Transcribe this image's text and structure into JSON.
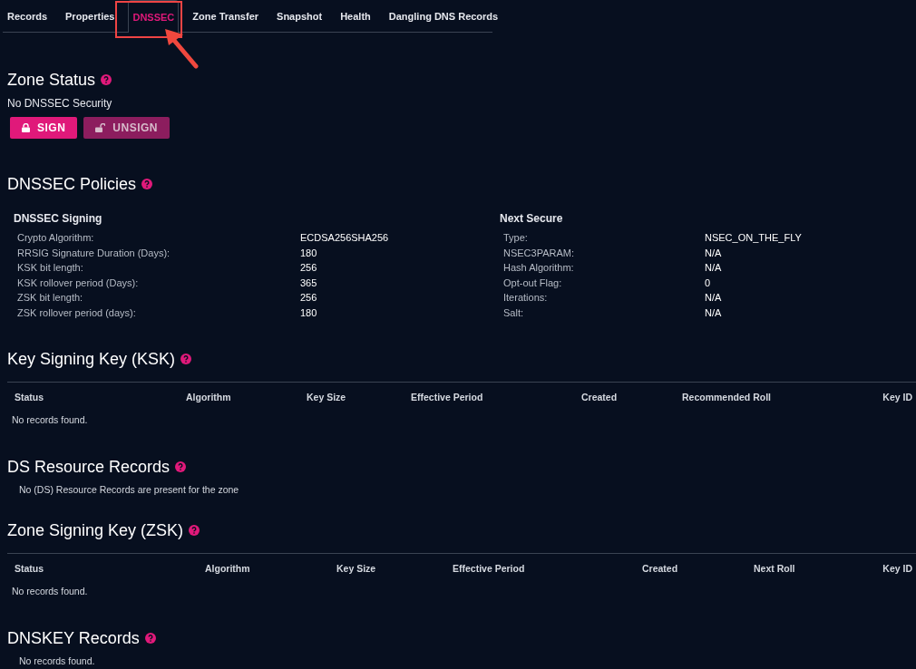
{
  "tabs": [
    {
      "label": "Records",
      "selected": false
    },
    {
      "label": "Properties",
      "selected": false
    },
    {
      "label": "DNSSEC",
      "selected": true
    },
    {
      "label": "Zone Transfer",
      "selected": false
    },
    {
      "label": "Snapshot",
      "selected": false
    },
    {
      "label": "Health",
      "selected": false
    },
    {
      "label": "Dangling DNS Records",
      "selected": false
    }
  ],
  "zone_status": {
    "title": "Zone Status",
    "status": "No DNSSEC Security",
    "buttons": [
      {
        "label": "SIGN",
        "kind": "lock",
        "disabled": false
      },
      {
        "label": "UNSIGN",
        "kind": "unlock",
        "disabled": true
      }
    ]
  },
  "policies": {
    "title": "DNSSEC Policies",
    "groups": [
      {
        "title": "DNSSEC Signing",
        "rows": [
          {
            "label": "Crypto Algorithm:",
            "value": "ECDSA256SHA256"
          },
          {
            "label": "RRSIG Signature Duration (Days):",
            "value": "180"
          },
          {
            "label": "KSK bit length:",
            "value": "256"
          },
          {
            "label": "KSK rollover period (Days):",
            "value": "365"
          },
          {
            "label": "ZSK bit length:",
            "value": "256"
          },
          {
            "label": "ZSK rollover period (days):",
            "value": "180"
          }
        ]
      },
      {
        "title": "Next Secure",
        "rows": [
          {
            "label": "Type:",
            "value": "NSEC_ON_THE_FLY"
          },
          {
            "label": "NSEC3PARAM:",
            "value": "N/A"
          },
          {
            "label": "Hash Algorithm:",
            "value": "N/A"
          },
          {
            "label": "Opt-out Flag:",
            "value": "0"
          },
          {
            "label": "Iterations:",
            "value": "N/A"
          },
          {
            "label": "Salt:",
            "value": "N/A"
          }
        ]
      }
    ]
  },
  "sections": [
    {
      "kind": "table",
      "title": "Key Signing Key (KSK)",
      "columns": [
        "Status",
        "Algorithm",
        "Key Size",
        "Effective Period",
        "Created",
        "Recommended Roll",
        "Key ID"
      ],
      "message": "No records found."
    },
    {
      "kind": "note",
      "title": "DS Resource Records",
      "message": "No (DS) Resource Records are present for the zone"
    },
    {
      "kind": "table",
      "title": "Zone Signing Key (ZSK)",
      "columns": [
        "Status",
        "Algorithm",
        "Key Size",
        "Effective Period",
        "Created",
        "Next Roll",
        "Key ID"
      ],
      "message": "No records found."
    },
    {
      "kind": "note",
      "title": "DNSKEY Records",
      "message": "No records found."
    }
  ]
}
